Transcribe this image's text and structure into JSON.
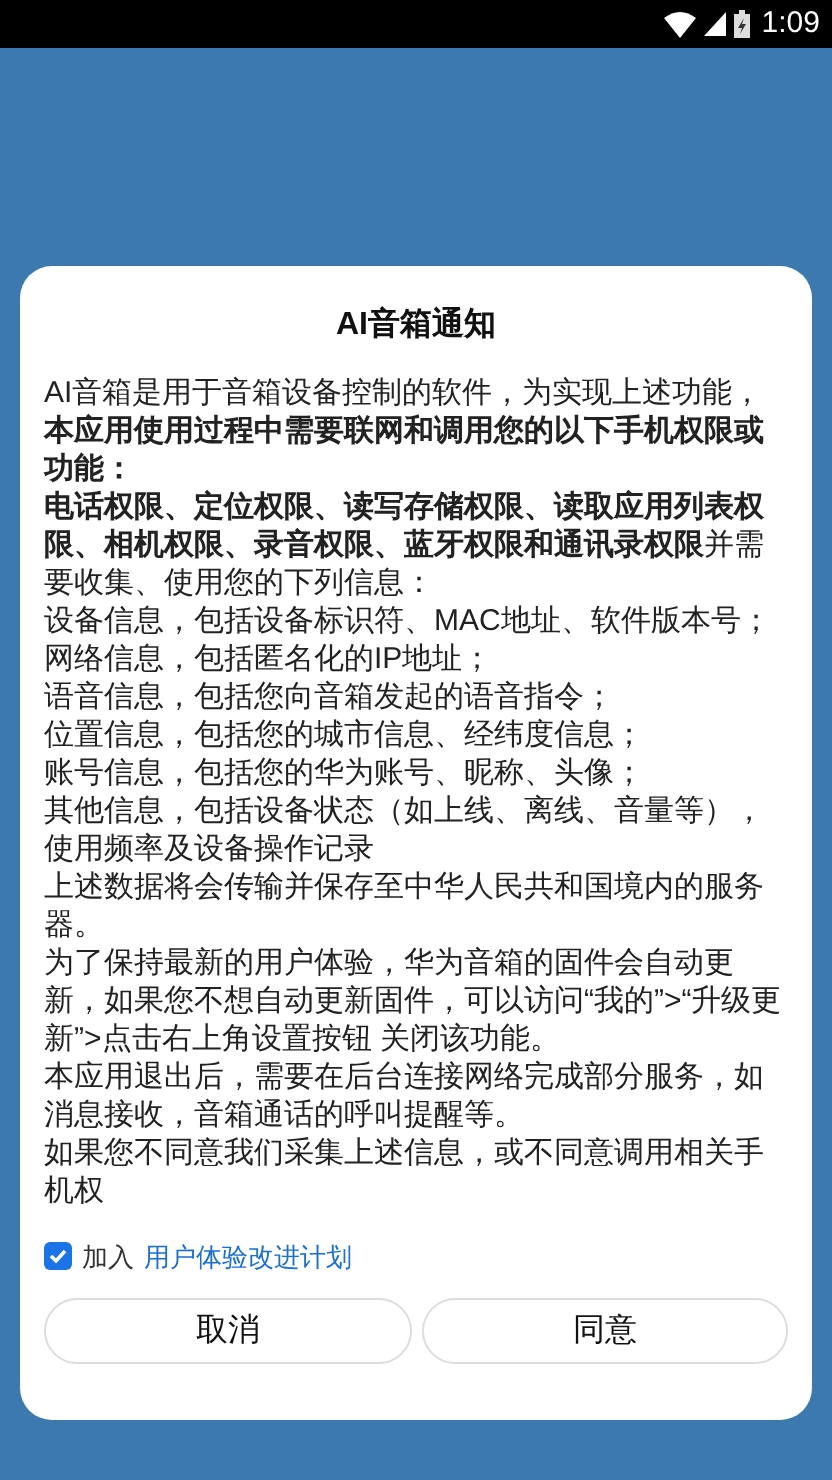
{
  "status_bar": {
    "time": "1:09"
  },
  "dialog": {
    "title": "AI音箱通知",
    "paragraphs": [
      "AI音箱是用于音箱设备控制的软件，为实现上述功能，**本应用使用过程中需要联网和调用您的以下手机权限或功能：**",
      "**电话权限、定位权限、读写存储权限、读取应用列表权限、相机权限、录音权限、蓝牙权限和通讯录权限**并需要收集、使用您的下列信息：",
      "设备信息，包括设备标识符、MAC地址、软件版本号；",
      "网络信息，包括匿名化的IP地址；",
      "语音信息，包括您向音箱发起的语音指令；",
      "位置信息，包括您的城市信息、经纬度信息；",
      "账号信息，包括您的华为账号、昵称、头像；",
      "其他信息，包括设备状态（如上线、离线、音量等），使用频率及设备操作记录",
      "上述数据将会传输并保存至中华人民共和国境内的服务器。",
      "为了保持最新的用户体验，华为音箱的固件会自动更新，如果您不想自动更新固件，可以访问“我的”>“升级更新”>点击右上角设置按钮 关闭该功能。",
      "本应用退出后，需要在后台连接网络完成部分服务，如消息接收，音箱通话的呼叫提醒等。",
      "如果您不同意我们采集上述信息，或不同意调用相关手机权"
    ],
    "consent": {
      "checked": true,
      "label": "加入",
      "link": "用户体验改进计划"
    },
    "buttons": [
      "取消",
      "同意"
    ]
  }
}
